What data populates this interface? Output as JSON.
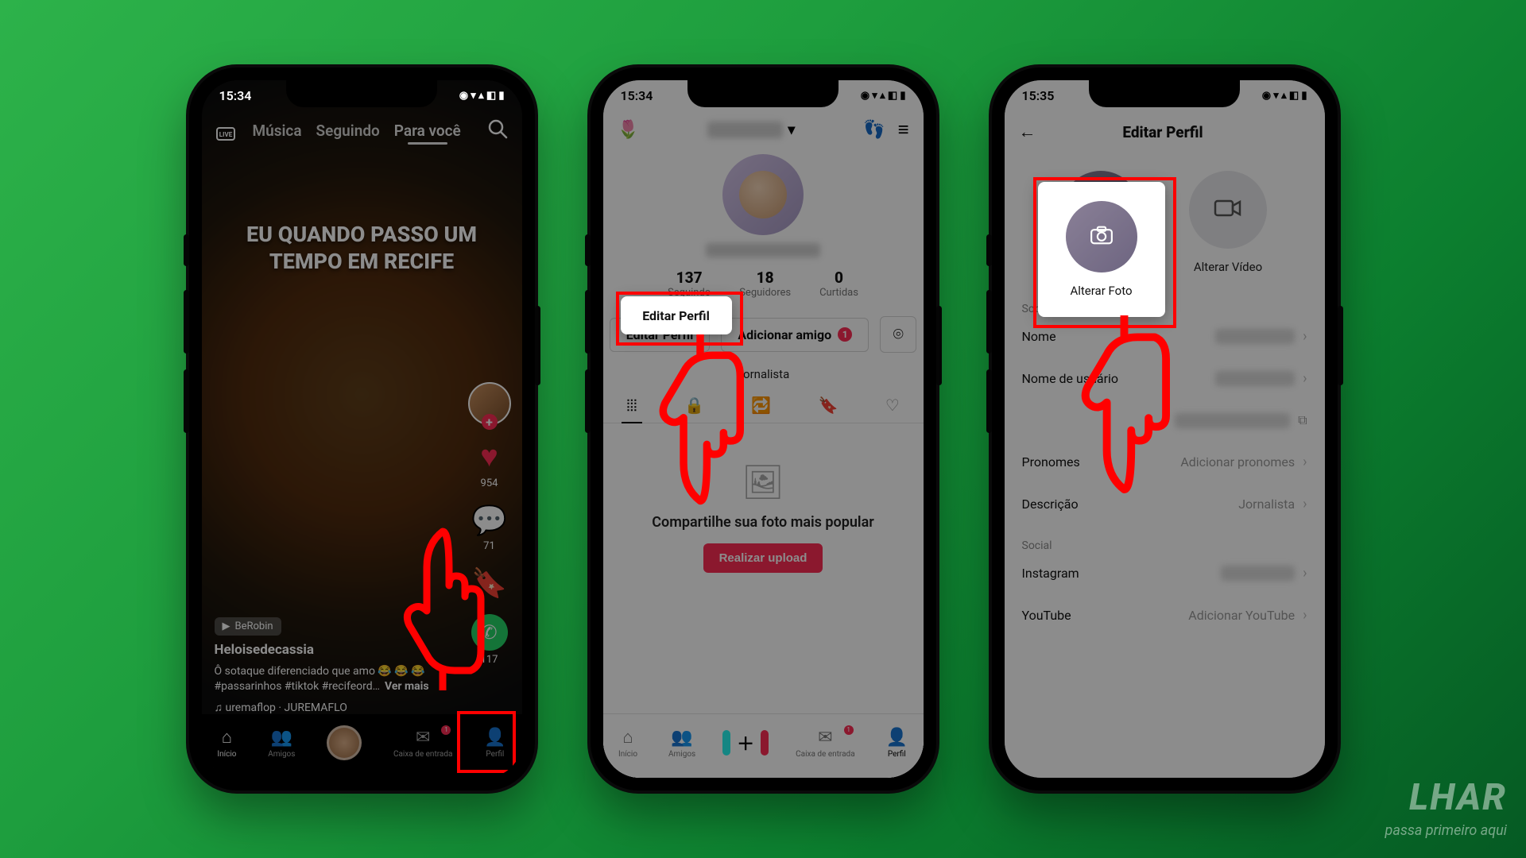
{
  "colors": {
    "accent_red": "#fe2c55",
    "highlight": "#ff0000",
    "whatsapp": "#25d366"
  },
  "screen1": {
    "time": "15:34",
    "tabs": {
      "music": "Música",
      "following": "Seguindo",
      "for_you": "Para você"
    },
    "caption": "EU QUANDO PASSO UM TEMPO EM RECIFE",
    "likes": "954",
    "comments": "71",
    "shares": "117",
    "pill": "BeRobin",
    "user": "Heloisedecassia",
    "desc": "Ô sotaque diferenciado que amo 😂 😂 😂 #passarinhos #tiktok #recifeord…",
    "more": "Ver mais",
    "music": "♫ uremaflop · JUREMAFLO",
    "nav": {
      "home": "Início",
      "friends": "Amigos",
      "inbox": "Caixa de entrada",
      "profile": "Perfil",
      "inbox_badge": "1"
    }
  },
  "screen2": {
    "time": "15:34",
    "stats": {
      "following_n": "137",
      "following_l": "Seguindo",
      "followers_n": "18",
      "followers_l": "Seguidores",
      "likes_n": "0",
      "likes_l": "Curtidas"
    },
    "edit_btn": "Editar Perfil",
    "add_friend": "Adicionar amigo",
    "add_friend_badge": "1",
    "bio": "Jornalista",
    "share_title": "Compartilhe sua foto mais popular",
    "upload_btn": "Realizar upload",
    "nav": {
      "home": "Início",
      "friends": "Amigos",
      "inbox": "Caixa de entrada",
      "profile": "Perfil",
      "inbox_badge": "1"
    }
  },
  "screen3": {
    "time": "15:35",
    "title": "Editar Perfil",
    "change_photo": "Alterar Foto",
    "change_video": "Alterar Vídeo",
    "section_about": "Sobre você",
    "rows": {
      "name": "Nome",
      "username": "Nome de usuário",
      "pronouns": "Pronomes",
      "pronouns_val": "Adicionar pronomes",
      "desc": "Descrição",
      "desc_val": "Jornalista"
    },
    "section_social": "Social",
    "social": {
      "instagram": "Instagram",
      "youtube": "YouTube",
      "youtube_val": "Adicionar YouTube"
    }
  },
  "watermark": {
    "l1": "LHAR",
    "l2": "passa primeiro aqui"
  }
}
